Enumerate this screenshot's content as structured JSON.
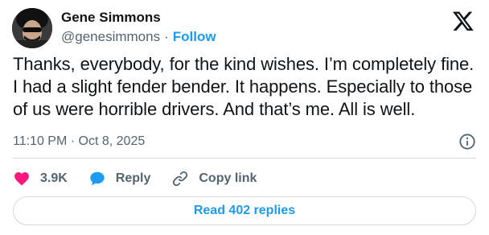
{
  "author": {
    "name": "Gene Simmons",
    "handle": "@genesimmons",
    "separator": "·",
    "follow_label": "Follow"
  },
  "tweet": {
    "text": "Thanks, everybody, for the kind wishes. I’m completely fine. I had a slight fender bender. It happens. Especially to those of us were horrible drivers. And that’s me. All is well.",
    "timestamp": "11:10 PM · Oct 8, 2025"
  },
  "actions": {
    "likes": "3.9K",
    "reply_label": "Reply",
    "copy_link_label": "Copy link"
  },
  "replies_button": {
    "label": "Read 402 replies"
  },
  "icons": {
    "platform": "x-logo-icon",
    "info": "info-icon",
    "like": "heart-icon",
    "reply": "speech-bubble-icon",
    "copy": "link-icon"
  },
  "colors": {
    "accent": "#1d9bf0",
    "like": "#f91880",
    "text": "#0f1419",
    "muted": "#536471",
    "border": "#cfd9de"
  }
}
